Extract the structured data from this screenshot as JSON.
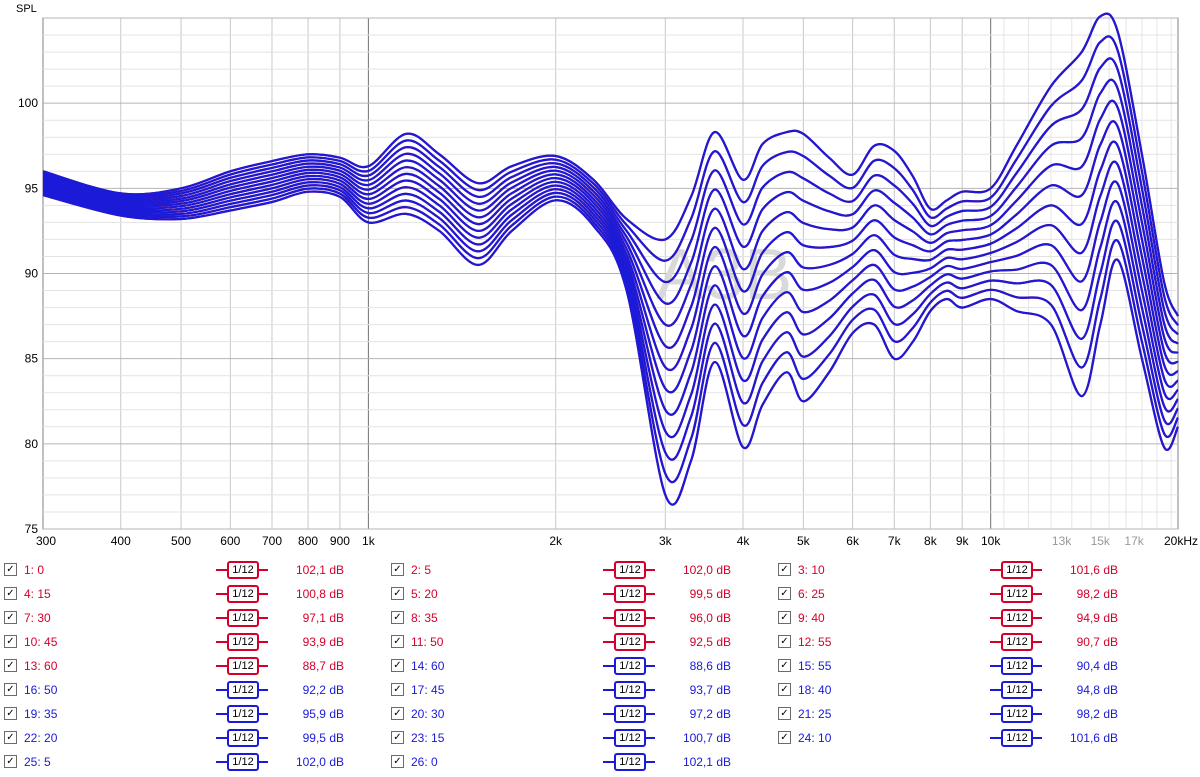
{
  "chart_data": {
    "type": "line",
    "ylabel": "SPL",
    "ylim": [
      75,
      105
    ],
    "xlim": [
      300,
      20000
    ],
    "x_scale": "log",
    "y_ticks": [
      "75",
      "80",
      "85",
      "90",
      "95",
      "100"
    ],
    "x_ticks": [
      "300",
      "400",
      "500",
      "600",
      "700",
      "800",
      "900",
      "1k",
      "2k",
      "3k",
      "4k",
      "5k",
      "6k",
      "7k",
      "8k",
      "9k",
      "10k",
      "13k",
      "15k",
      "17k",
      "20kHz"
    ],
    "watermark": "A3B",
    "grid": true,
    "colors": {
      "red": "#d4002a",
      "blue": "#1a1ad8",
      "dim_tick": "#999999"
    },
    "series": [
      {
        "name": "1: 0",
        "color": "red",
        "level": "102,1 dB"
      },
      {
        "name": "2: 5",
        "color": "red",
        "level": "102,0 dB"
      },
      {
        "name": "3: 10",
        "color": "red",
        "level": "101,6 dB"
      },
      {
        "name": "4: 15",
        "color": "red",
        "level": "100,8 dB"
      },
      {
        "name": "5: 20",
        "color": "red",
        "level": "99,5 dB"
      },
      {
        "name": "6: 25",
        "color": "red",
        "level": "98,2 dB"
      },
      {
        "name": "7: 30",
        "color": "red",
        "level": "97,1 dB"
      },
      {
        "name": "8: 35",
        "color": "red",
        "level": "96,0 dB"
      },
      {
        "name": "9: 40",
        "color": "red",
        "level": "94,9 dB"
      },
      {
        "name": "10: 45",
        "color": "red",
        "level": "93,9 dB"
      },
      {
        "name": "11: 50",
        "color": "red",
        "level": "92,5 dB"
      },
      {
        "name": "12: 55",
        "color": "red",
        "level": "90,7 dB"
      },
      {
        "name": "13: 60",
        "color": "red",
        "level": "88,7 dB"
      },
      {
        "name": "14: 60",
        "color": "blue",
        "level": "88,6 dB"
      },
      {
        "name": "15: 55",
        "color": "blue",
        "level": "90,4 dB"
      },
      {
        "name": "16: 50",
        "color": "blue",
        "level": "92,2 dB"
      },
      {
        "name": "17: 45",
        "color": "blue",
        "level": "93,7 dB"
      },
      {
        "name": "18: 40",
        "color": "blue",
        "level": "94,8 dB"
      },
      {
        "name": "19: 35",
        "color": "blue",
        "level": "95,9 dB"
      },
      {
        "name": "20: 30",
        "color": "blue",
        "level": "97,2 dB"
      },
      {
        "name": "21: 25",
        "color": "blue",
        "level": "98,2 dB"
      },
      {
        "name": "22: 20",
        "color": "blue",
        "level": "99,5 dB"
      },
      {
        "name": "23: 15",
        "color": "blue",
        "level": "100,7 dB"
      },
      {
        "name": "24: 10",
        "color": "blue",
        "level": "101,6 dB"
      },
      {
        "name": "25: 5",
        "color": "blue",
        "level": "102,0 dB"
      },
      {
        "name": "26: 0",
        "color": "blue",
        "level": "102,1 dB"
      }
    ],
    "smoothing_label": "1/12",
    "checkbox_checked": true,
    "approx_curves": {
      "x": [
        300,
        400,
        500,
        600,
        700,
        800,
        900,
        1000,
        1150,
        1300,
        1500,
        1700,
        2000,
        2300,
        2600,
        3000,
        3300,
        3600,
        4000,
        4300,
        4700,
        5000,
        5500,
        6000,
        6500,
        7000,
        7500,
        8000,
        8500,
        9000,
        10000,
        11000,
        12500,
        14000,
        15000,
        16000,
        17500,
        19000,
        20000
      ],
      "angle_0_y": [
        96.0,
        94.7,
        95.0,
        96.0,
        96.6,
        97.0,
        96.8,
        96.3,
        98.2,
        97.0,
        95.3,
        96.3,
        96.9,
        95.5,
        93.2,
        92.0,
        94.5,
        98.3,
        95.5,
        97.6,
        98.3,
        98.2,
        96.8,
        95.8,
        97.5,
        97.2,
        95.7,
        93.8,
        94.3,
        94.8,
        95.0,
        97.5,
        101.0,
        103.0,
        105.1,
        104.2,
        97.0,
        89.5,
        87.5
      ],
      "angle_60_y": [
        94.6,
        93.4,
        93.2,
        93.7,
        94.2,
        94.8,
        94.5,
        93.0,
        93.5,
        92.5,
        90.5,
        92.5,
        94.3,
        92.8,
        89.0,
        77.0,
        79.0,
        84.8,
        79.8,
        82.3,
        84.2,
        82.5,
        84.2,
        86.5,
        87.0,
        85.0,
        86.0,
        87.8,
        88.5,
        88.0,
        88.5,
        87.8,
        87.0,
        82.8,
        87.0,
        90.8,
        85.0,
        79.8,
        81.0
      ]
    }
  }
}
